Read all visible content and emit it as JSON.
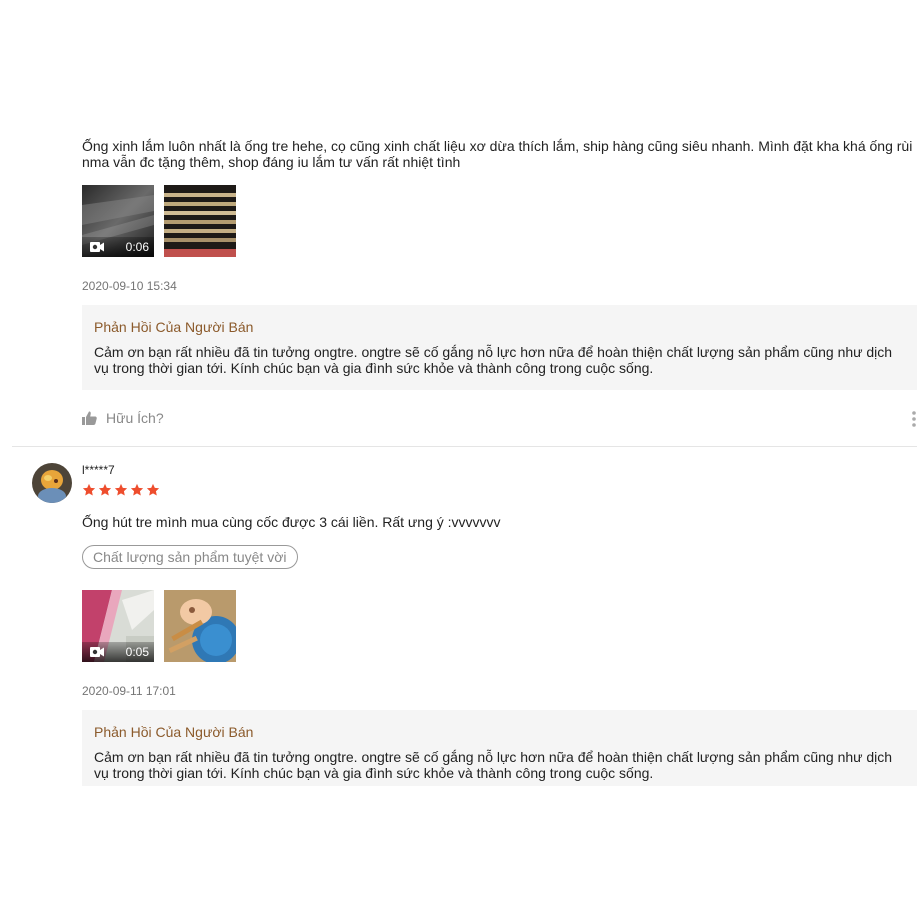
{
  "review1": {
    "text": "Ống xinh lắm luôn nhất là ống tre hehe, cọ cũng xinh chất liệu xơ dừa thích lắm, ship hàng cũng siêu nhanh. Mình đặt kha khá ống rùi nma vẫn đc tặng thêm, shop đáng iu lắm tư vấn rất nhiệt tình",
    "video_duration": "0:06",
    "date": "2020-09-10 15:34",
    "reply_title": "Phản Hồi Của Người Bán",
    "reply_body": "Cảm ơn bạn rất nhiều đã tin tưởng ongtre. ongtre sẽ cố gắng nỗ lực hơn nữa để hoàn thiện chất lượng sản phẩm cũng như dịch vụ trong thời gian tới. Kính chúc bạn và gia đình sức khỏe và thành công trong cuộc sống.",
    "helpful_label": "Hữu Ích?"
  },
  "review2": {
    "username": "l*****7",
    "rating": 5,
    "text": "Ống hút tre mình mua cùng cốc được 3 cái liền. Rất ưng ý :vvvvvvv",
    "tag": "Chất lượng sản phẩm tuyệt vời",
    "video_duration": "0:05",
    "date": "2020-09-11 17:01",
    "reply_title": "Phản Hồi Của Người Bán",
    "reply_body": "Cảm ơn bạn rất nhiều đã tin tưởng ongtre. ongtre sẽ cố gắng nỗ lực hơn nữa để hoàn thiện chất lượng sản phẩm cũng như dịch vụ trong thời gian tới. Kính chúc bạn và gia đình sức khỏe và thành công trong cuộc sống."
  },
  "colors": {
    "star": "#ee4d2d",
    "reply_title": "#8b5a2b",
    "reply_bg": "#f5f5f5",
    "meta_text": "#757575"
  },
  "icons": {
    "video": "video-camera-icon",
    "helpful": "thumbs-up-icon",
    "more": "more-vertical-icon",
    "star": "star-icon"
  }
}
